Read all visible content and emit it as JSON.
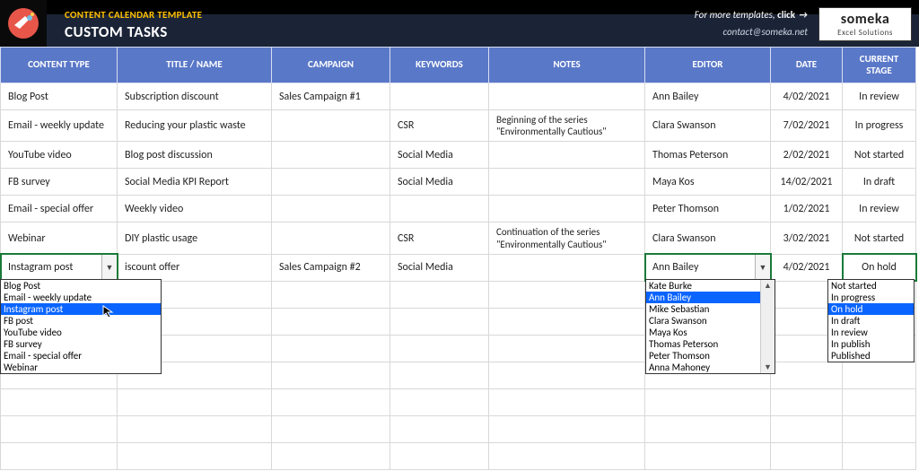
{
  "header": {
    "template_label": "CONTENT CALENDAR TEMPLATE",
    "page_title": "CUSTOM TASKS",
    "more_templates_prefix": "For more templates, ",
    "more_templates_bold": "click",
    "contact_email": "contact@someka.net",
    "brand_main": "someka",
    "brand_sub": "Excel Solutions"
  },
  "columns": {
    "type": "CONTENT TYPE",
    "title": "TITLE / NAME",
    "campaign": "CAMPAIGN",
    "keywords": "KEYWORDS",
    "notes": "NOTES",
    "editor": "EDITOR",
    "date": "DATE",
    "stage": "CURRENT STAGE"
  },
  "rows": [
    {
      "type": "Blog Post",
      "title": "Subscription discount",
      "campaign": "Sales Campaign #1",
      "keywords": "",
      "notes": "",
      "editor": "Ann Bailey",
      "date": "4/02/2021",
      "stage": "In review"
    },
    {
      "type": "Email - weekly update",
      "title": "Reducing your plastic waste",
      "campaign": "",
      "keywords": "CSR",
      "notes": "Beginning of the series \"Environmentally Cautious\"",
      "editor": "Clara Swanson",
      "date": "7/02/2021",
      "stage": "In progress"
    },
    {
      "type": "YouTube video",
      "title": "Blog post discussion",
      "campaign": "",
      "keywords": "Social Media",
      "notes": "",
      "editor": "Thomas Peterson",
      "date": "2/02/2021",
      "stage": "Not started"
    },
    {
      "type": "FB survey",
      "title": "Social Media KPI Report",
      "campaign": "",
      "keywords": "Social Media",
      "notes": "",
      "editor": "Maya Kos",
      "date": "14/02/2021",
      "stage": "In draft"
    },
    {
      "type": "Email - special offer",
      "title": "Weekly video",
      "campaign": "",
      "keywords": "",
      "notes": "",
      "editor": "Peter Thomson",
      "date": "1/02/2021",
      "stage": "In review"
    },
    {
      "type": "Webinar",
      "title": "DIY plastic usage",
      "campaign": "",
      "keywords": "CSR",
      "notes": "Continuation of the series \"Environmentally Cautious\"",
      "editor": "Clara Swanson",
      "date": "3/02/2021",
      "stage": "Not started"
    },
    {
      "type": "Instagram post",
      "title": "iscount offer",
      "campaign": "Sales Campaign #2",
      "keywords": "Social Media",
      "notes": "",
      "editor": "Ann Bailey",
      "date": "4/02/2021",
      "stage": "On hold"
    }
  ],
  "dropdowns": {
    "content_type": {
      "options": [
        "Blog Post",
        "Email - weekly update",
        "Instagram post",
        "FB post",
        "YouTube video",
        "FB survey",
        "Email - special offer",
        "Webinar"
      ],
      "highlight_index": 2
    },
    "editor": {
      "options": [
        "Kate Burke",
        "Ann Bailey",
        "Mike Sebastian",
        "Clara Swanson",
        "Maya Kos",
        "Thomas Peterson",
        "Peter Thomson",
        "Anna Mahoney"
      ],
      "highlight_index": 1
    },
    "stage": {
      "options": [
        "Not started",
        "In progress",
        "On hold",
        "In draft",
        "In review",
        "In publish",
        "Published"
      ],
      "highlight_index": 2
    }
  }
}
